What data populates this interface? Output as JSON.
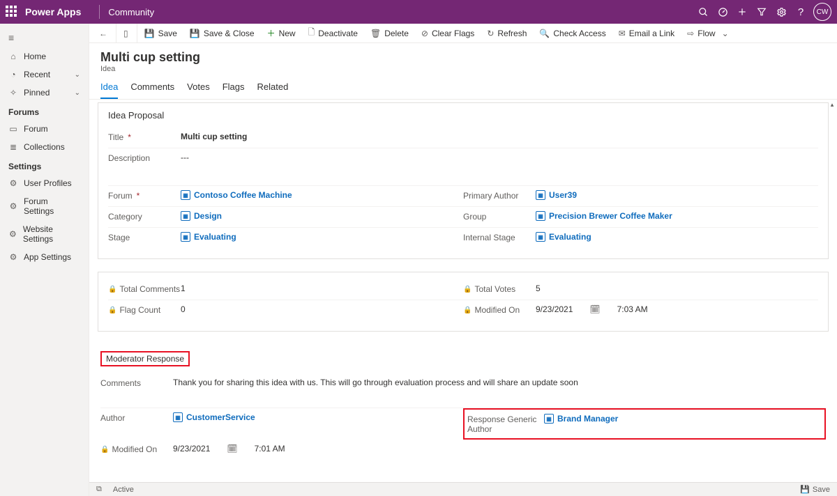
{
  "top": {
    "brand": "Power Apps",
    "env": "Community",
    "avatar": "CW"
  },
  "sidebar": {
    "home": "Home",
    "recent": "Recent",
    "pinned": "Pinned",
    "g_forums": "Forums",
    "forum": "Forum",
    "collections": "Collections",
    "g_settings": "Settings",
    "user_profiles": "User Profiles",
    "forum_settings": "Forum Settings",
    "website_settings": "Website Settings",
    "app_settings": "App Settings"
  },
  "cmd": {
    "save": "Save",
    "saveclose": "Save & Close",
    "new": "New",
    "deactivate": "Deactivate",
    "delete": "Delete",
    "clearflags": "Clear Flags",
    "refresh": "Refresh",
    "checkaccess": "Check Access",
    "emaillink": "Email a Link",
    "flow": "Flow"
  },
  "record": {
    "title": "Multi cup setting",
    "entity": "Idea"
  },
  "tabs": {
    "idea": "Idea",
    "comments": "Comments",
    "votes": "Votes",
    "flags": "Flags",
    "related": "Related"
  },
  "proposal": {
    "heading": "Idea Proposal",
    "title_lbl": "Title",
    "title_val": "Multi cup setting",
    "desc_lbl": "Description",
    "desc_val": "---",
    "forum_lbl": "Forum",
    "forum_val": "Contoso Coffee Machine",
    "category_lbl": "Category",
    "category_val": "Design",
    "stage_lbl": "Stage",
    "stage_val": "Evaluating",
    "pauthor_lbl": "Primary Author",
    "pauthor_val": "User39",
    "group_lbl": "Group",
    "group_val": "Precision Brewer Coffee Maker",
    "istage_lbl": "Internal Stage",
    "istage_val": "Evaluating"
  },
  "stats": {
    "totcomments_lbl": "Total Comments",
    "totcomments_val": "1",
    "flagcount_lbl": "Flag Count",
    "flagcount_val": "0",
    "totvotes_lbl": "Total Votes",
    "totvotes_val": "5",
    "modon_lbl": "Modified On",
    "modon_date": "9/23/2021",
    "modon_time": "7:03 AM"
  },
  "mod": {
    "heading": "Moderator Response",
    "comments_lbl": "Comments",
    "comments_val": "Thank you for sharing this idea with us. This will go through evaluation process and will share an update soon",
    "author_lbl": "Author",
    "author_val": "CustomerService",
    "rga_lbl": "Response Generic Author",
    "rga_val": "Brand Manager",
    "modon_lbl": "Modified On",
    "modon_date": "9/23/2021",
    "modon_time": "7:01 AM"
  },
  "status": {
    "state": "Active",
    "save": "Save"
  }
}
